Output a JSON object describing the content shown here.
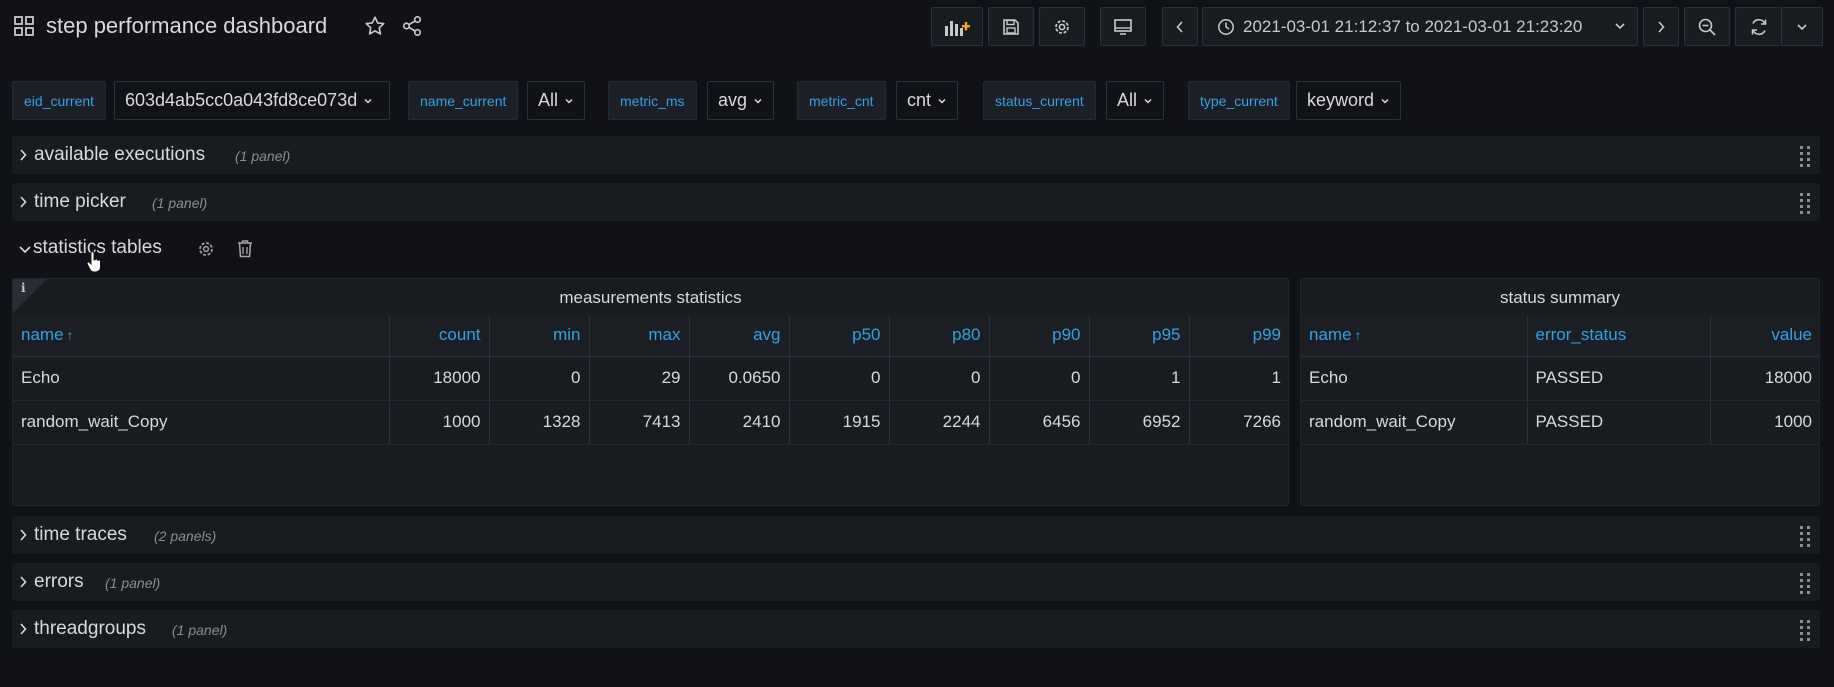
{
  "header": {
    "title": "step performance dashboard",
    "time_range": "2021-03-01 21:12:37 to 2021-03-01 21:23:20"
  },
  "variables": [
    {
      "label": "eid_current",
      "value": "603d4ab5cc0a043fd8ce073d"
    },
    {
      "label": "name_current",
      "value": "All"
    },
    {
      "label": "metric_ms",
      "value": "avg"
    },
    {
      "label": "metric_cnt",
      "value": "cnt"
    },
    {
      "label": "status_current",
      "value": "All"
    },
    {
      "label": "type_current",
      "value": "keyword"
    }
  ],
  "rows": [
    {
      "title": "available executions",
      "count": "(1 panel)"
    },
    {
      "title": "time picker",
      "count": "(1 panel)"
    },
    {
      "title": "statistics tables"
    },
    {
      "title": "time traces",
      "count": "(2 panels)"
    },
    {
      "title": "errors",
      "count": "(1 panel)"
    },
    {
      "title": "threadgroups",
      "count": "(1 panel)"
    }
  ],
  "measurements": {
    "title": "measurements statistics",
    "info": "i",
    "sort_arrow": "↑",
    "columns": [
      "name",
      "count",
      "min",
      "max",
      "avg",
      "p50",
      "p80",
      "p90",
      "p95",
      "p99"
    ],
    "rows": [
      [
        "Echo",
        "18000",
        "0",
        "29",
        "0.0650",
        "0",
        "0",
        "0",
        "1",
        "1"
      ],
      [
        "random_wait_Copy",
        "1000",
        "1328",
        "7413",
        "2410",
        "1915",
        "2244",
        "6456",
        "6952",
        "7266"
      ]
    ]
  },
  "status_summary": {
    "title": "status summary",
    "sort_arrow": "↑",
    "columns": [
      "name",
      "error_status",
      "value"
    ],
    "rows": [
      [
        "Echo",
        "PASSED",
        "18000"
      ],
      [
        "random_wait_Copy",
        "PASSED",
        "1000"
      ]
    ]
  },
  "colors": {
    "background": "#111217",
    "panel": "#181b1f",
    "accent_blue": "#33a2e5",
    "text": "#d8d9da",
    "add_panel_orange": "#f5a623"
  }
}
